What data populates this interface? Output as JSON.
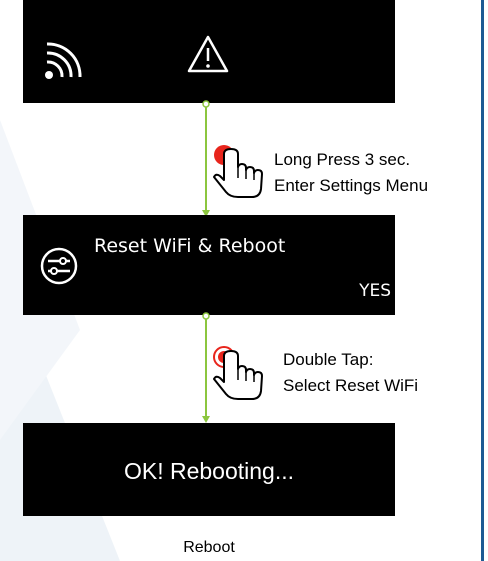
{
  "screens": {
    "status": {
      "icons": [
        "wifi-icon",
        "warning-icon"
      ]
    },
    "settings": {
      "title": "Reset WiFi & Reboot",
      "option": "YES",
      "icon": "settings-sliders-icon"
    },
    "rebooting": {
      "message": "OK! Rebooting..."
    }
  },
  "steps": [
    {
      "line1": "Long Press 3 sec.",
      "line2": "Enter Settings Menu",
      "icon": "press-hand-icon"
    },
    {
      "line1": "Double Tap:",
      "line2": "Select Reset WiFi",
      "icon": "double-tap-hand-icon"
    }
  ],
  "caption": "Reboot",
  "colors": {
    "connector": "#8cc63f",
    "press": "#e8251c",
    "border": "#1e5a94",
    "screen": "#000000"
  }
}
